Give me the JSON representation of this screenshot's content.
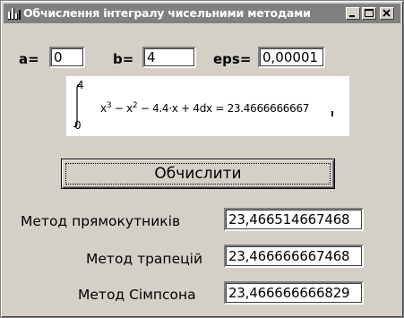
{
  "window": {
    "title": "Обчислення інтегралу чисельними методами"
  },
  "inputs": {
    "a_label": "a=",
    "a_value": "0",
    "b_label": "b=",
    "b_value": "4",
    "eps_label": "eps=",
    "eps_value": "0,00001"
  },
  "formula": {
    "upper_limit": "4",
    "lower_limit": "0",
    "term1_base": "x",
    "term1_exp": "3",
    "minus1": "−",
    "term2_base": "x",
    "term2_exp": "2",
    "rest": "− 4.4·x + 4dx = 23.4666666667"
  },
  "button": {
    "calculate_label": "Обчислити"
  },
  "results": [
    {
      "label": "Метод прямокутників",
      "value": "23,466514667468"
    },
    {
      "label": "Метод трапецій",
      "value": "23,466666667468"
    },
    {
      "label": "Метод Сімпсона",
      "value": "23,466666666829"
    }
  ],
  "icons": {
    "app": "chart-bars-icon",
    "minimize": "minimize-icon",
    "maximize": "maximize-icon",
    "close": "close-icon"
  },
  "colors": {
    "window_bg": "#d4d0c8",
    "titlebar_bg": "#808080",
    "titlebar_text": "#ffffff"
  }
}
